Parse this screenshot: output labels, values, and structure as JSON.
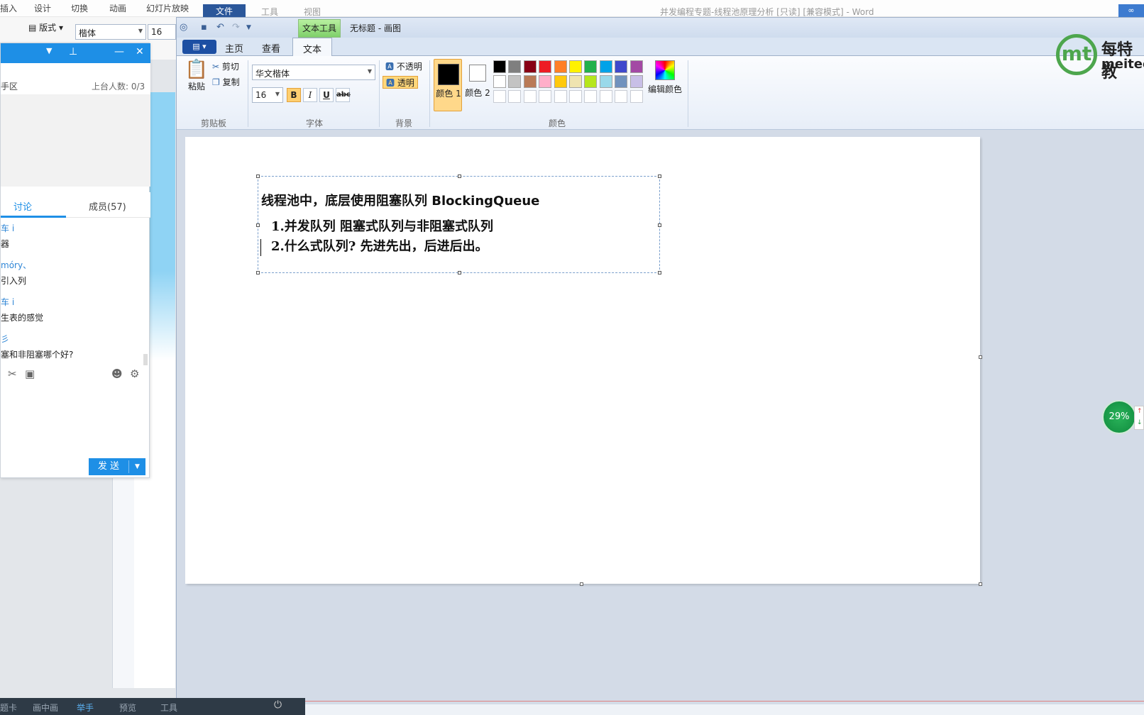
{
  "word": {
    "menu": [
      "插入",
      "设计",
      "切换",
      "动画",
      "幻灯片放映"
    ],
    "file_tab": "文件",
    "menu_right": [
      "工具",
      "视图"
    ],
    "title": "并发编程专题-线程池原理分析 [只读] [兼容模式] - Word",
    "layout_btn": "版式",
    "font_name": "楷体",
    "font_size": "16",
    "body_label": "体"
  },
  "qq": {
    "area_label": "手区",
    "stage_count": "上台人数: 0/3",
    "tab_discuss": "讨论",
    "tab_members": "成员(57)",
    "messages": [
      {
        "name": "车 i",
        "text": "器"
      },
      {
        "name": "móry、",
        "text": "引入列"
      },
      {
        "name": "车 i",
        "text": "生表的感觉"
      },
      {
        "name": "彡",
        "text": "塞和非阻塞哪个好?"
      }
    ],
    "send_label": "发 送"
  },
  "paint": {
    "text_tools_tab": "文本工具",
    "title": "无标题 - 画图",
    "tabs": [
      "主页",
      "查看",
      "文本"
    ],
    "clipboard": {
      "paste": "粘贴",
      "cut": "剪切",
      "copy": "复制",
      "group": "剪贴板"
    },
    "font": {
      "name": "华文楷体",
      "size": "16",
      "bold": "B",
      "italic": "I",
      "underline": "U",
      "strike": "abc",
      "group": "字体"
    },
    "background": {
      "opaque": "不透明",
      "transparent": "透明",
      "group": "背景"
    },
    "colors": {
      "color1": "颜色 1",
      "color2": "颜色 2",
      "edit": "编辑颜色",
      "group": "颜色",
      "color1_value": "#000000",
      "color2_value": "#ffffff"
    },
    "palette": [
      [
        "#000000",
        "#7f7f7f",
        "#880015",
        "#ed1c24",
        "#ff7f27",
        "#fff200",
        "#22b14c",
        "#00a2e8",
        "#3f48cc",
        "#a349a4"
      ],
      [
        "#ffffff",
        "#c3c3c3",
        "#b97a57",
        "#ffaec9",
        "#ffc90e",
        "#efe4b0",
        "#b5e61d",
        "#99d9ea",
        "#7092be",
        "#c8bfe7"
      ],
      [
        "#ffffff",
        "#ffffff",
        "#ffffff",
        "#ffffff",
        "#ffffff",
        "#ffffff",
        "#ffffff",
        "#ffffff",
        "#ffffff",
        "#ffffff"
      ]
    ],
    "text_lines": [
      "线程池中，底层使用阻塞队列",
      "BlockingQueue",
      "1.并发队列 阻塞式队列与非阻塞式队列",
      "2.什么式队列?   先进先出，后进后出。"
    ]
  },
  "logo": {
    "mark": "mt",
    "cn": "每特教",
    "en": "meiteed"
  },
  "net_badge": "29%",
  "taskbar": [
    "题卡",
    "画中画",
    "举手",
    "预览",
    "工具"
  ]
}
